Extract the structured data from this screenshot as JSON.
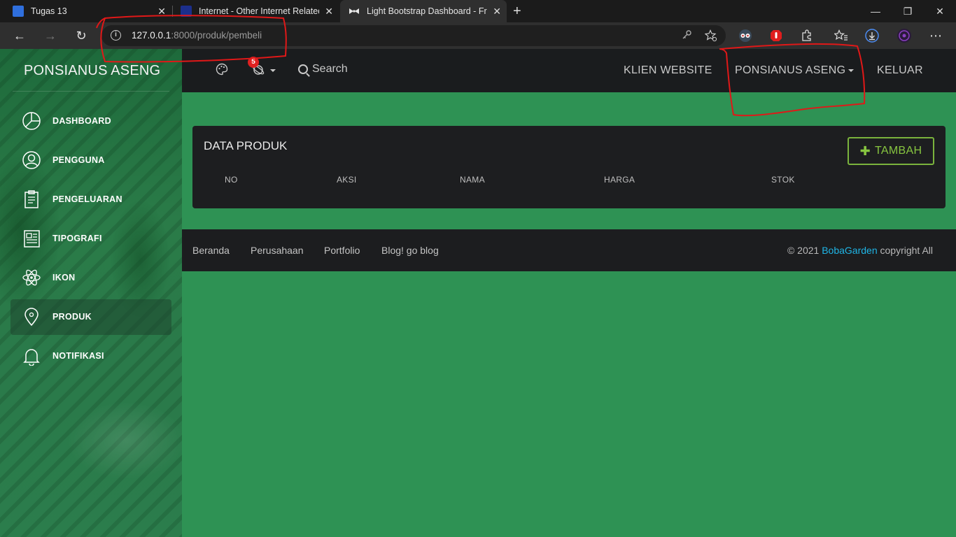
{
  "browser": {
    "tabs": [
      {
        "title": "Tugas 13",
        "close": "✕"
      },
      {
        "title": "Internet - Other Internet Related",
        "close": "✕"
      },
      {
        "title": "Light Bootstrap Dashboard - Free",
        "close": "✕"
      }
    ],
    "new_tab": "+",
    "window": {
      "minimize": "—",
      "restore": "❐",
      "close": "✕"
    },
    "nav": {
      "back": "←",
      "forward": "→",
      "reload": "↻"
    },
    "url_host": "127.0.0.1",
    "url_rest": ":8000/produk/pembeli",
    "more": "⋯"
  },
  "sidebar": {
    "brand": "PONSIANUS ASENG",
    "items": [
      {
        "label": "DASHBOARD",
        "icon": "pie-chart-icon"
      },
      {
        "label": "PENGGUNA",
        "icon": "user-circle-icon"
      },
      {
        "label": "PENGELUARAN",
        "icon": "clipboard-icon"
      },
      {
        "label": "TIPOGRAFI",
        "icon": "newspaper-icon"
      },
      {
        "label": "IKON",
        "icon": "atom-icon"
      },
      {
        "label": "PRODUK",
        "icon": "map-pin-icon",
        "active": true
      },
      {
        "label": "NOTIFIKASI",
        "icon": "bell-icon"
      }
    ]
  },
  "topnav": {
    "notif_count": "5",
    "search": "Search",
    "links": {
      "klien": "KLIEN WEBSITE",
      "user": "PONSIANUS ASENG",
      "logout": "KELUAR"
    }
  },
  "card": {
    "title": "DATA PRODUK",
    "add_button": "TAMBAH",
    "columns": [
      "NO",
      "AKSI",
      "NAMA",
      "HARGA",
      "STOK"
    ]
  },
  "footer": {
    "links": [
      "Beranda",
      "Perusahaan",
      "Portfolio",
      "Blog! go blog"
    ],
    "copy_prefix": "© 2021 ",
    "copy_brand": "BobaGarden",
    "copy_suffix": " copyright All"
  },
  "colors": {
    "content_bg": "#2e9254",
    "dark_panel": "#1d1e20",
    "accent_green": "#87c540",
    "link_blue": "#1fb5e6",
    "badge_red": "#e02020",
    "annotation_red": "#e01818"
  }
}
